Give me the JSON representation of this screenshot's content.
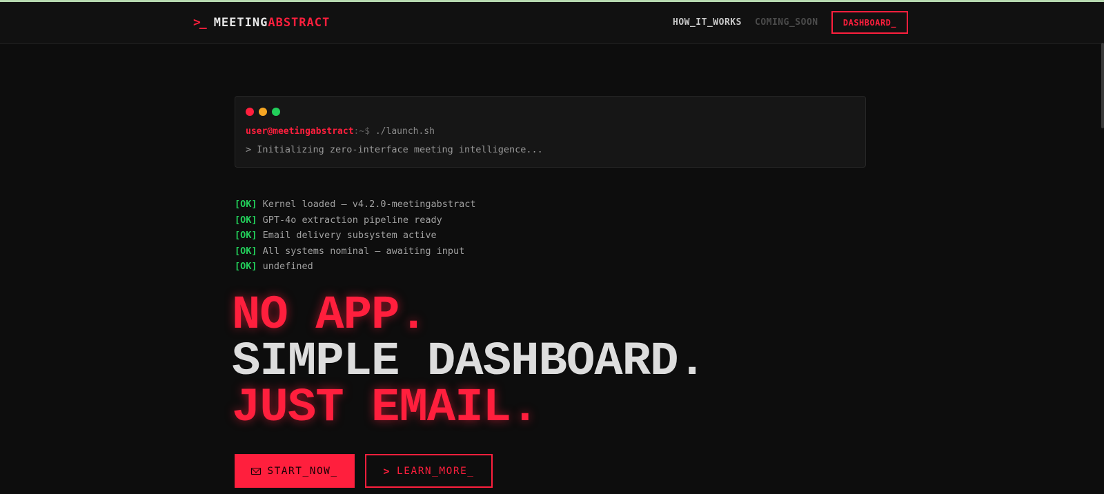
{
  "brand": {
    "icon": "terminal-prompt-icon",
    "icon_glyph": ">_",
    "name_part1": "MEETING",
    "name_part2": "ABSTRACT",
    "accent_color": "#ff1f3d"
  },
  "nav": {
    "how_it_works": "HOW_IT_WORKS",
    "coming_soon": "COMING_SOON",
    "dashboard": "DASHBOARD_"
  },
  "terminal": {
    "user_host": "user@meetingabstract",
    "path": ":~$",
    "command": " ./launch.sh",
    "output": "> Initializing zero-interface meeting intelligence..."
  },
  "boot_log": [
    {
      "tag": "[OK]",
      "text": "Kernel loaded — v4.2.0-meetingabstract"
    },
    {
      "tag": "[OK]",
      "text": "GPT-4o extraction pipeline ready"
    },
    {
      "tag": "[OK]",
      "text": "Email delivery subsystem active"
    },
    {
      "tag": "[OK]",
      "text": "All systems nominal — awaiting input"
    },
    {
      "tag": "[OK]",
      "text": "undefined"
    }
  ],
  "hero": {
    "line1": "NO APP.",
    "line2": "SIMPLE DASHBOARD.",
    "line3": "JUST EMAIL."
  },
  "cta": {
    "start_icon": "mail-icon",
    "start_label": "START_NOW_",
    "learn_icon": "chevron-right-icon",
    "learn_glyph": ">",
    "learn_label": "LEARN_MORE_"
  }
}
